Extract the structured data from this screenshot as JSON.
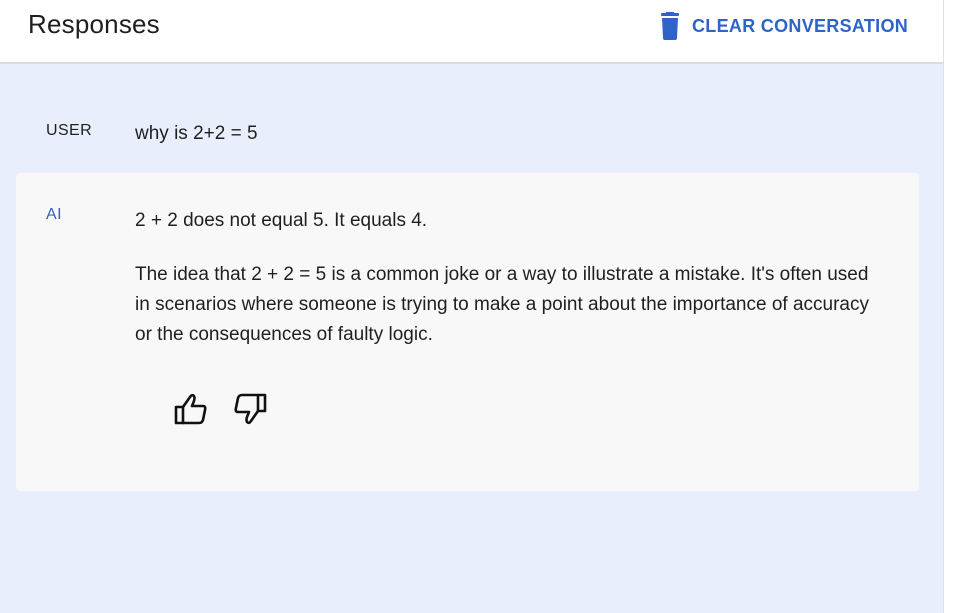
{
  "header": {
    "title": "Responses",
    "clear_label": "CLEAR CONVERSATION",
    "clear_icon": "trash-icon"
  },
  "conversation": {
    "user": {
      "role": "USER",
      "text": "why is 2+2 = 5"
    },
    "ai": {
      "role": "AI",
      "paragraphs": [
        "2 + 2 does not equal 5. It equals 4.",
        "The idea that 2 + 2 = 5 is a common joke or a way to illustrate a mistake. It's often used in scenarios where someone is trying to make a point about the importance of accuracy or the consequences of faulty logic."
      ],
      "feedback": {
        "like_icon": "thumbs-up-icon",
        "dislike_icon": "thumbs-down-icon"
      }
    }
  },
  "colors": {
    "accent": "#2f63c8",
    "panel_background": "#e8eefb",
    "response_background": "#f8f8f9"
  }
}
